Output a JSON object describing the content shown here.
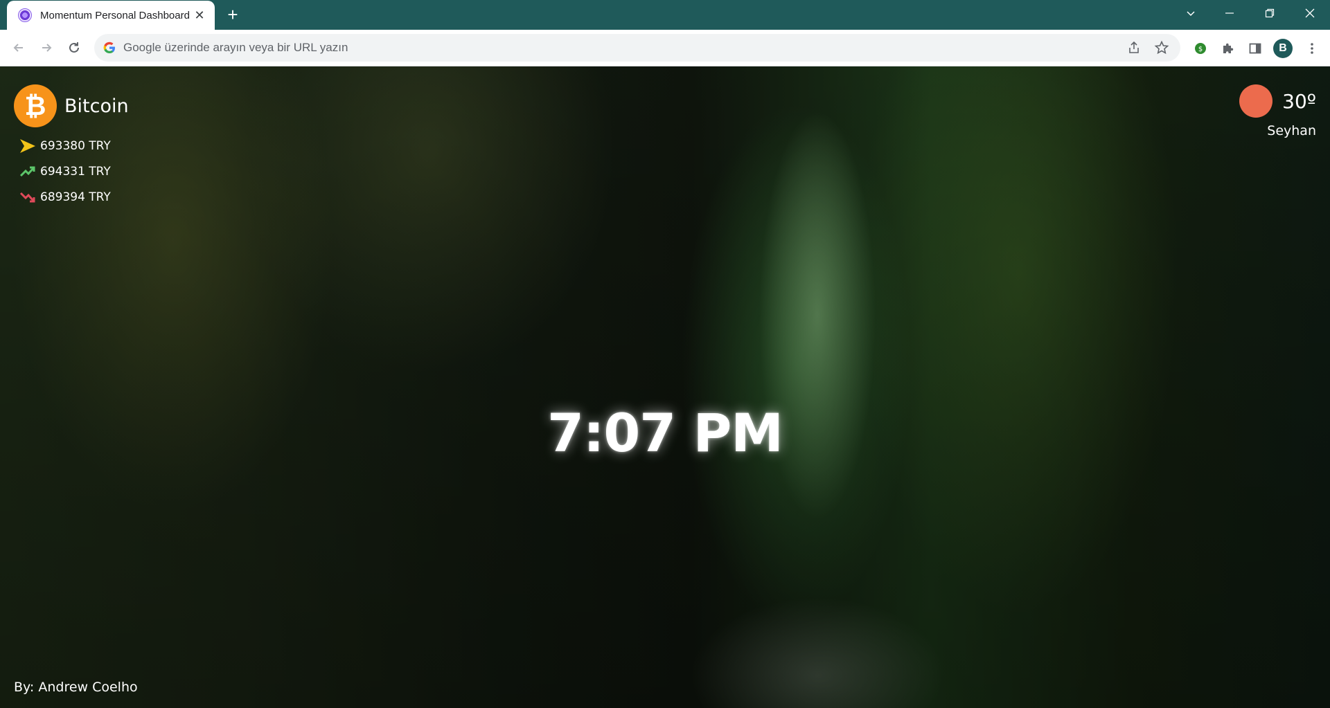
{
  "browser": {
    "tab_title": "Momentum Personal Dashboard",
    "new_tab_symbol": "+",
    "close_symbol": "✕",
    "omnibox_placeholder": "Google üzerinde arayın veya bir URL yazın",
    "profile_initial": "B"
  },
  "crypto": {
    "name": "Bitcoin",
    "logo_symbol": "₿",
    "current": "693380 TRY",
    "high": "694331 TRY",
    "low": "689394 TRY",
    "colors": {
      "current": "#f2c319",
      "high": "#5cc66a",
      "low": "#e04a5a",
      "logo": "#f7931a"
    }
  },
  "weather": {
    "temperature": "30º",
    "city": "Seyhan",
    "icon": "sun-icon",
    "icon_color": "#ec6b4d"
  },
  "clock": {
    "time": "7:07 PM"
  },
  "author": {
    "credit": "By: Andrew Coelho"
  }
}
